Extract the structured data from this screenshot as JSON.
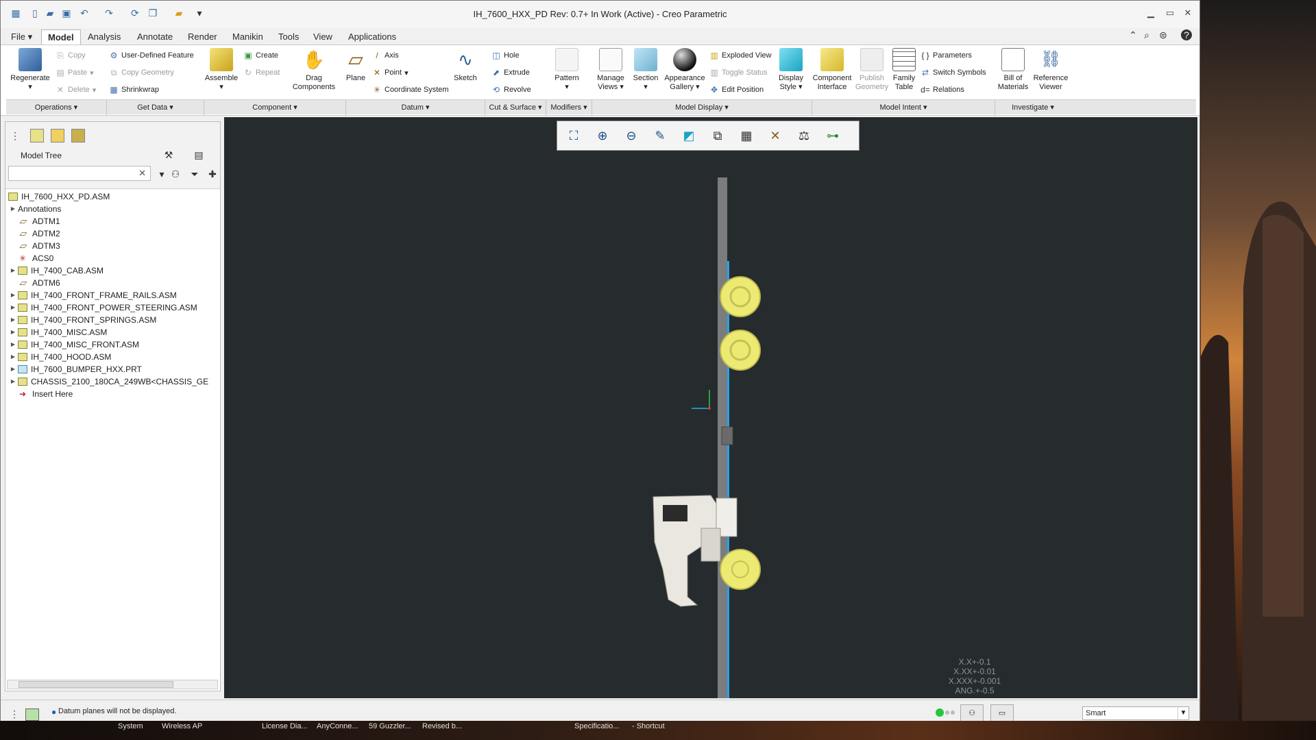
{
  "window": {
    "title": "IH_7600_HXX_PD Rev: 0.7+ In Work  (Active) - Creo Parametric"
  },
  "tabs": [
    "File",
    "Model",
    "Analysis",
    "Annotate",
    "Render",
    "Manikin",
    "Tools",
    "View",
    "Applications"
  ],
  "ribbon": {
    "regenerate": "Regenerate",
    "copy": "Copy",
    "paste": "Paste",
    "delete": "Delete",
    "user_defined_feature": "User-Defined Feature",
    "copy_geometry": "Copy Geometry",
    "shrinkwrap": "Shrinkwrap",
    "assemble": "Assemble",
    "create": "Create",
    "repeat": "Repeat",
    "drag_components": "Drag Components",
    "plane": "Plane",
    "axis": "Axis",
    "point": "Point",
    "coordinate_system": "Coordinate System",
    "sketch": "Sketch",
    "hole": "Hole",
    "extrude": "Extrude",
    "revolve": "Revolve",
    "pattern": "Pattern",
    "manage_views": "Manage Views",
    "section": "Section",
    "appearance_gallery": "Appearance Gallery",
    "exploded_view": "Exploded View",
    "toggle_status": "Toggle Status",
    "edit_position": "Edit Position",
    "display_style": "Display Style",
    "component_interface": "Component Interface",
    "publish_geometry": "Publish Geometry",
    "family_table": "Family Table",
    "parameters": "Parameters",
    "switch_symbols": "Switch Symbols",
    "relations": "Relations",
    "bill_of_materials": "Bill of Materials",
    "reference_viewer": "Reference Viewer"
  },
  "groups": [
    "Operations",
    "Get Data",
    "Component",
    "Datum",
    "Cut & Surface",
    "Modifiers",
    "Model Display",
    "Model Intent",
    "Investigate"
  ],
  "model_tree": {
    "title": "Model Tree",
    "items": [
      {
        "label": "IH_7600_HXX_PD.ASM"
      },
      {
        "label": "Annotations"
      },
      {
        "label": "ADTM1"
      },
      {
        "label": "ADTM2"
      },
      {
        "label": "ADTM3"
      },
      {
        "label": "ACS0"
      },
      {
        "label": "IH_7400_CAB.ASM"
      },
      {
        "label": "ADTM6"
      },
      {
        "label": "IH_7400_FRONT_FRAME_RAILS.ASM"
      },
      {
        "label": "IH_7400_FRONT_POWER_STEERING.ASM"
      },
      {
        "label": "IH_7400_FRONT_SPRINGS.ASM"
      },
      {
        "label": "IH_7400_MISC.ASM"
      },
      {
        "label": "IH_7400_MISC_FRONT.ASM"
      },
      {
        "label": "IH_7400_HOOD.ASM"
      },
      {
        "label": "IH_7600_BUMPER_HXX.PRT"
      },
      {
        "label": "CHASSIS_2100_180CA_249WB<CHASSIS_GE"
      },
      {
        "label": "Insert Here"
      }
    ]
  },
  "tolerances": [
    "X.X+-0.1",
    "X.XX+-0.01",
    "X.XXX+-0.001",
    "ANG.+-0.5"
  ],
  "status": {
    "message": "Datum planes will not be displayed.",
    "filter": "Smart"
  },
  "taskbar": [
    "System",
    "Wireless AP",
    "License Dia...",
    "AnyConne...",
    "59 Guzzler...",
    "Revised b...",
    "Specificatio...",
    "- Shortcut"
  ]
}
